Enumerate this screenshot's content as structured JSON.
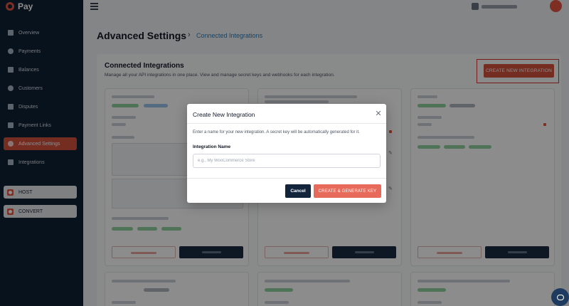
{
  "app": {
    "name": "Pay"
  },
  "sidebar": {
    "items": [
      {
        "label": "Overview",
        "icon": "grid-icon"
      },
      {
        "label": "Payments",
        "icon": "dollar-icon"
      },
      {
        "label": "Balances",
        "icon": "wallet-icon"
      },
      {
        "label": "Customers",
        "icon": "user-icon"
      },
      {
        "label": "Disputes",
        "icon": "document-icon"
      },
      {
        "label": "Payment Links",
        "icon": "link-icon"
      },
      {
        "label": "Advanced Settings",
        "icon": "gear-icon",
        "active": true
      },
      {
        "label": "Integrations",
        "icon": "puzzle-icon"
      }
    ],
    "extensions": [
      {
        "label": "HOST"
      },
      {
        "label": "CONVERT"
      }
    ]
  },
  "header": {
    "title": "Advanced Settings",
    "separator": "›",
    "breadcrumb": "Connected Integrations"
  },
  "section": {
    "title": "Connected Integrations",
    "subtitle": "Manage all your API integrations in one place. View and manage secret keys and webhooks for each integration.",
    "new_button": "CREATE NEW INTEGRATION"
  },
  "modal": {
    "title": "Create New Integration",
    "description": "Enter a name for your new integration. A secret key will be automatically generated for it.",
    "field_label": "Integration Name",
    "field_placeholder": "e.g., My WooCommerce Store",
    "field_value": "",
    "cancel_label": "Cancel",
    "create_label": "CREATE & GENERATE KEY"
  },
  "colors": {
    "sidebar_bg": "#0f2236",
    "accent": "#d6523f",
    "primary_dark": "#13253b"
  }
}
